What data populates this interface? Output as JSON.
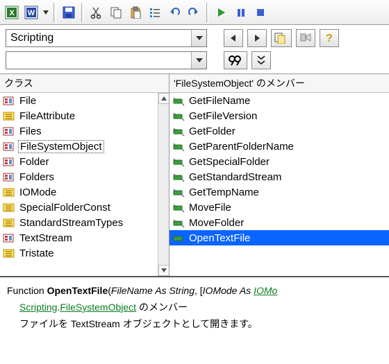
{
  "toolbar": {
    "icons": [
      "excel",
      "word",
      "dropdown",
      "save",
      "cut",
      "copy",
      "paste",
      "list",
      "undo",
      "redo",
      "play",
      "pause",
      "stop"
    ]
  },
  "search": {
    "library_value": "Scripting",
    "filter_value": ""
  },
  "buttons": {
    "nav_back": "◀",
    "nav_fwd": "▶",
    "copy_decl": "",
    "pin": "",
    "help": "?"
  },
  "panes": {
    "left": {
      "header": "クラス",
      "items": [
        {
          "icon": "class",
          "label": "File"
        },
        {
          "icon": "enum",
          "label": "FileAttribute"
        },
        {
          "icon": "class",
          "label": "Files"
        },
        {
          "icon": "class",
          "label": "FileSystemObject",
          "selected": true
        },
        {
          "icon": "class",
          "label": "Folder"
        },
        {
          "icon": "class",
          "label": "Folders"
        },
        {
          "icon": "enum",
          "label": "IOMode"
        },
        {
          "icon": "enum",
          "label": "SpecialFolderConst"
        },
        {
          "icon": "enum",
          "label": "StandardStreamTypes"
        },
        {
          "icon": "class",
          "label": "TextStream"
        },
        {
          "icon": "enum",
          "label": "Tristate"
        }
      ]
    },
    "right": {
      "header": "'FileSystemObject' のメンバー",
      "items": [
        {
          "icon": "method",
          "label": "GetFileName"
        },
        {
          "icon": "method",
          "label": "GetFileVersion"
        },
        {
          "icon": "method",
          "label": "GetFolder"
        },
        {
          "icon": "method",
          "label": "GetParentFolderName"
        },
        {
          "icon": "method",
          "label": "GetSpecialFolder"
        },
        {
          "icon": "method",
          "label": "GetStandardStream"
        },
        {
          "icon": "method",
          "label": "GetTempName"
        },
        {
          "icon": "method",
          "label": "MoveFile"
        },
        {
          "icon": "method",
          "label": "MoveFolder"
        },
        {
          "icon": "method",
          "label": "OpenTextFile",
          "selected": true
        }
      ]
    }
  },
  "footer": {
    "sig_prefix": "Function ",
    "sig_name": "OpenTextFile",
    "sig_open": "(",
    "sig_p1_name": "FileName",
    "sig_p1_as": " As String",
    "sig_comma": ", [",
    "sig_p2_name": "IOMode",
    "sig_p2_as": " As ",
    "sig_p2_type": "IOMo",
    "member_link1": "Scripting",
    "member_dot": ".",
    "member_link2": "FileSystemObject",
    "member_suffix": " のメンバー",
    "desc": "ファイルを TextStream オブジェクトとして開きます。"
  }
}
